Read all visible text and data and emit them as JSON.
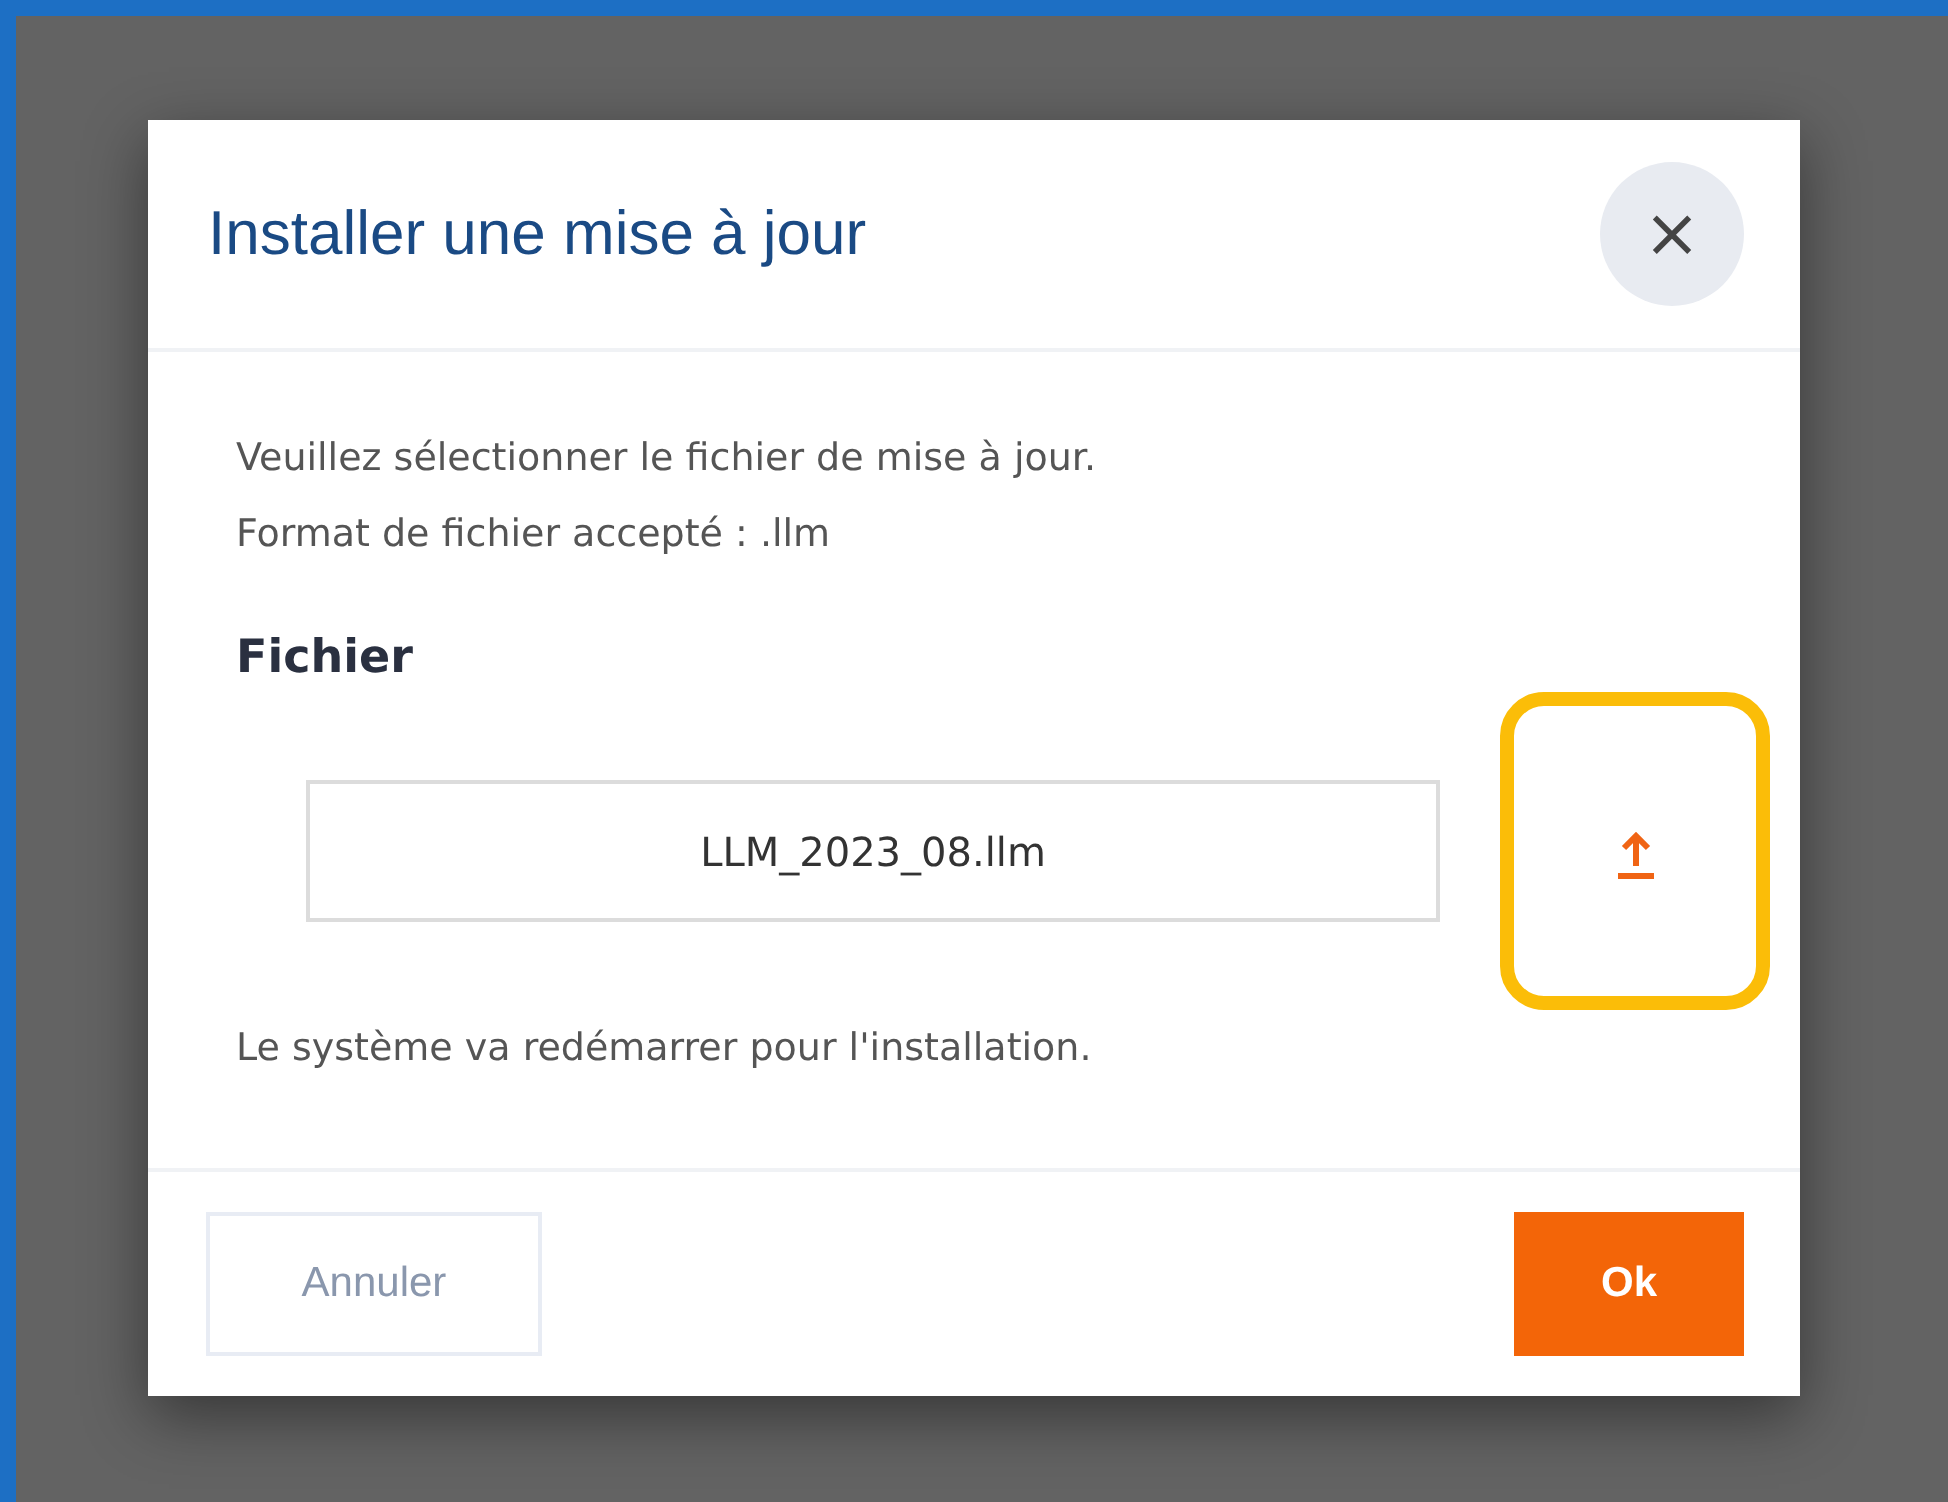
{
  "dialog": {
    "title": "Installer une mise à jour",
    "close_label": "×"
  },
  "instructions": [
    "Veuillez sélectionner le fichier de mise à jour.",
    "Format de fichier accepté : .llm"
  ],
  "file_field": {
    "label": "Fichier",
    "value": "LLM_2023_08.llm"
  },
  "upload_button": {
    "highlighted": true
  },
  "note": "Le système va redémarrer pour l'installation.",
  "buttons": [
    {
      "label": "Annuler",
      "kind": "secondary"
    },
    {
      "label": "Ok",
      "kind": "primary"
    }
  ]
}
